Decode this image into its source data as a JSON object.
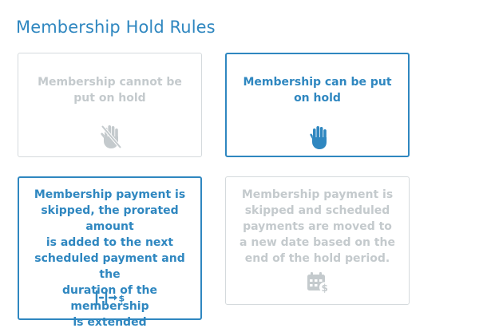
{
  "page": {
    "title": "Membership Hold Rules"
  },
  "colors": {
    "accent": "#2f87c0",
    "muted_text": "#c4cacd",
    "border": "#d5dadd"
  },
  "options": [
    {
      "label_lines": [
        "Membership cannot be",
        "put on hold"
      ],
      "selected": false,
      "icon": "hand-slash-icon"
    },
    {
      "label_lines": [
        "Membership can be put",
        "on hold"
      ],
      "selected": true,
      "icon": "hand-icon"
    },
    {
      "label_lines": [
        "Membership payment is",
        "skipped, the prorated amount",
        "is added to the next",
        "scheduled payment and the",
        "duration of the membership",
        "is extended"
      ],
      "selected": true,
      "icon": "extend-duration-icon",
      "icon_text": "|-|→$"
    },
    {
      "label_lines": [
        "Membership payment is",
        "skipped and scheduled",
        "payments are moved to",
        "a new date based on the",
        "end of the hold period."
      ],
      "selected": false,
      "icon": "calendar-dollar-icon"
    }
  ]
}
